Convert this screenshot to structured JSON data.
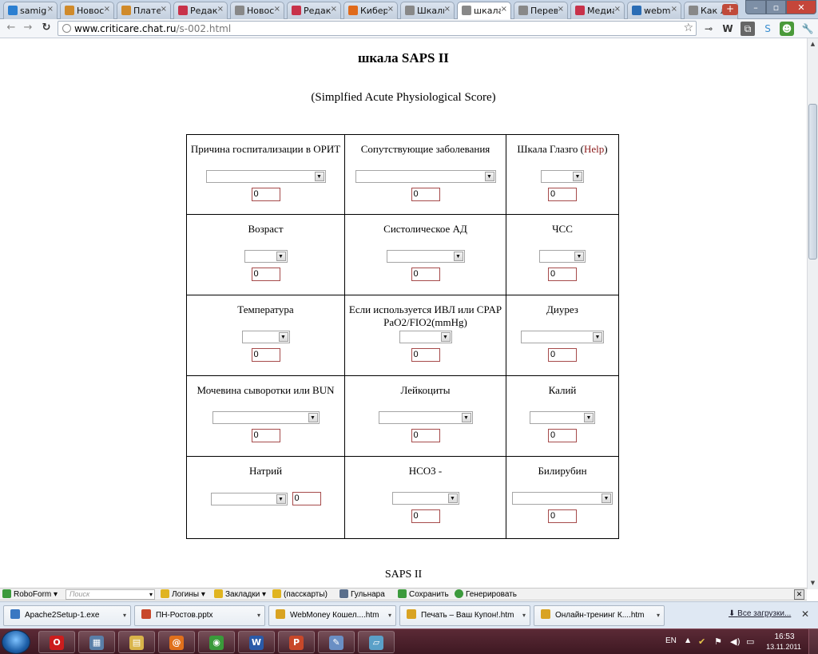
{
  "tabs": [
    {
      "label": "samig",
      "icon": "skype-icon",
      "color": "#2b7fd1"
    },
    {
      "label": "Новос",
      "icon": "news-icon",
      "color": "#d08a2a"
    },
    {
      "label": "Плате",
      "icon": "news-icon",
      "color": "#d08a2a"
    },
    {
      "label": "Редакт",
      "icon": "heart-icon",
      "color": "#c8324a"
    },
    {
      "label": "Новос",
      "icon": "chrome-icon",
      "color": "#888888"
    },
    {
      "label": "Редакт",
      "icon": "heart-icon",
      "color": "#c8324a"
    },
    {
      "label": "Кибер",
      "icon": "blogger-icon",
      "color": "#e06a1b"
    },
    {
      "label": "Шкалы",
      "icon": "chrome-icon",
      "color": "#888888"
    },
    {
      "label": "шкала",
      "icon": "chrome-icon",
      "color": "#888888",
      "active": true
    },
    {
      "label": "Перев",
      "icon": "chrome-icon",
      "color": "#888888"
    },
    {
      "label": "Медиа",
      "icon": "heart-icon",
      "color": "#c8324a"
    },
    {
      "label": "webmo",
      "icon": "webmoney-icon",
      "color": "#2b6db5"
    },
    {
      "label": "Как ле",
      "icon": "chrome-icon",
      "color": "#888888"
    }
  ],
  "address": {
    "host": "www.criticare.chat.ru",
    "path": "/s-002.html"
  },
  "page": {
    "title": "шкала SAPS II",
    "subtitle": "(Simplfied Acute Physiological Score)",
    "footer": "SAPS II",
    "help_link": "Help",
    "rows": [
      [
        {
          "label": "Причина госпитализации в ОРИТ",
          "score": "0",
          "select_width": 150
        },
        {
          "label": "Сопутствующие заболевания",
          "score": "0",
          "select_width": 176
        },
        {
          "label": "Шкала Глазго (",
          "label_suffix": ")",
          "has_help": true,
          "score": "0",
          "select_width": 54
        }
      ],
      [
        {
          "label": "Возраст",
          "score": "0",
          "select_width": 54
        },
        {
          "label": "Систолическое АД",
          "score": "0",
          "select_width": 98
        },
        {
          "label": "ЧСС",
          "score": "0",
          "select_width": 58
        }
      ],
      [
        {
          "label": "Температура",
          "score": "0",
          "select_width": 60
        },
        {
          "label": "Если используется ИВЛ или CPAP PaO2/FIO2(mmHg)",
          "score": "0",
          "select_width": 66
        },
        {
          "label": "Диурез",
          "score": "0",
          "select_width": 104
        }
      ],
      [
        {
          "label": "Мочевина сыворотки или BUN",
          "score": "0",
          "select_width": 134
        },
        {
          "label": "Лейкоциты",
          "score": "0",
          "select_width": 118
        },
        {
          "label": "Калий",
          "score": "0",
          "select_width": 82
        }
      ],
      [
        {
          "label": "Натрий",
          "score": "0",
          "select_width": 96,
          "inline_score": true
        },
        {
          "label": "HCO3 -",
          "score": "0",
          "select_width": 84
        },
        {
          "label": "Билирубин",
          "score": "0",
          "select_width": 126
        }
      ]
    ]
  },
  "roboform": {
    "brand": "RoboForm",
    "search_placeholder": "Поиск",
    "logins": "Логины",
    "bookmarks": "Закладки",
    "passcards": "(пасскарты)",
    "identity": "Гульнара",
    "save": "Сохранить",
    "generate": "Генерировать"
  },
  "downloads": {
    "items": [
      {
        "name": "Apache2Setup-1.exe",
        "icon": "installer-icon",
        "color": "#3a78c2"
      },
      {
        "name": "ПН-Ростов.pptx",
        "icon": "powerpoint-icon",
        "color": "#c8482a"
      },
      {
        "name": "WebMoney Кошел....htm",
        "icon": "chrome-icon",
        "color": "#d9a322"
      },
      {
        "name": "Печать – Ваш Купон!.htm",
        "icon": "chrome-icon",
        "color": "#d9a322"
      },
      {
        "name": "Онлайн-тренинг К....htm",
        "icon": "chrome-icon",
        "color": "#d9a322"
      }
    ],
    "all_label": "Все загрузки..."
  },
  "taskbar": {
    "apps": [
      {
        "icon": "opera-icon",
        "glyph": "O",
        "color": "#cc1d1d"
      },
      {
        "icon": "calculator-icon",
        "glyph": "▦",
        "color": "#5a7fa8"
      },
      {
        "icon": "explorer-folder-icon",
        "glyph": "▤",
        "color": "#d9b44a"
      },
      {
        "icon": "mail-agent-icon",
        "glyph": "@",
        "color": "#e0701c"
      },
      {
        "icon": "chrome-icon",
        "glyph": "◉",
        "color": "#3a9a3a"
      },
      {
        "icon": "word-icon",
        "glyph": "W",
        "color": "#2a5aa8"
      },
      {
        "icon": "powerpoint-icon",
        "glyph": "P",
        "color": "#c8482a"
      },
      {
        "icon": "paint-icon",
        "glyph": "✎",
        "color": "#6a8fc4"
      },
      {
        "icon": "notebook-icon",
        "glyph": "▱",
        "color": "#5aa0c8"
      }
    ],
    "lang": "EN",
    "time": "16:53",
    "date": "13.11.2011"
  }
}
